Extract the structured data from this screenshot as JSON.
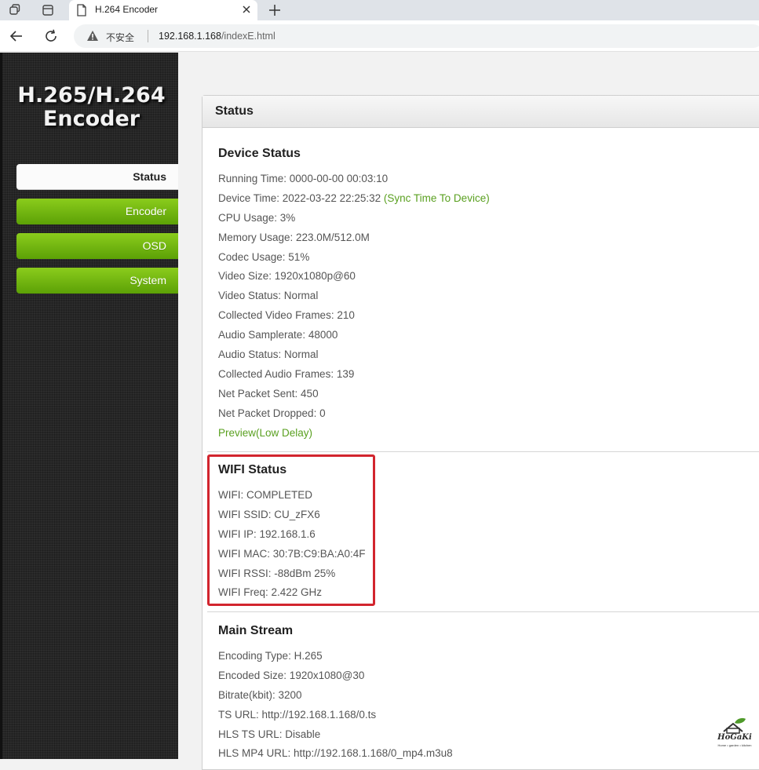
{
  "browser": {
    "tab_title": "H.264 Encoder",
    "security_label": "不安全",
    "url_host": "192.168.1.168",
    "url_path": "/indexE.html"
  },
  "sidebar": {
    "logo_line1": "H.265/H.264",
    "logo_line2": "Encoder",
    "items": [
      {
        "label": "Status",
        "active": true
      },
      {
        "label": "Encoder",
        "active": false
      },
      {
        "label": "OSD",
        "active": false
      },
      {
        "label": "System",
        "active": false
      }
    ]
  },
  "panel": {
    "title": "Status"
  },
  "device_status": {
    "title": "Device Status",
    "running_time": "Running Time: 0000-00-00 00:03:10",
    "device_time": "Device Time: 2022-03-22 22:25:32",
    "sync_link": "(Sync Time To Device)",
    "cpu_usage": "CPU Usage: 3%",
    "memory_usage": "Memory Usage: 223.0M/512.0M",
    "codec_usage": "Codec Usage: 51%",
    "video_size": "Video Size: 1920x1080p@60",
    "video_status": "Video Status: Normal",
    "video_frames": "Collected Video Frames: 210",
    "audio_samplerate": "Audio Samplerate: 48000",
    "audio_status": "Audio Status: Normal",
    "audio_frames": "Collected Audio Frames: 139",
    "packets_sent": "Net Packet Sent: 450",
    "packets_dropped": "Net Packet Dropped: 0",
    "preview_link": "Preview(Low Delay)"
  },
  "wifi_status": {
    "title": "WIFI Status",
    "state": "WIFI: COMPLETED",
    "ssid": "WIFI SSID: CU_zFX6",
    "ip": "WIFI IP: 192.168.1.6",
    "mac": "WIFI MAC: 30:7B:C9:BA:A0:4F",
    "rssi": "WIFI RSSI: -88dBm 25%",
    "freq": "WIFI Freq: 2.422 GHz"
  },
  "main_stream": {
    "title": "Main Stream",
    "encoding_type": "Encoding Type: H.265",
    "encoded_size": "Encoded Size: 1920x1080@30",
    "bitrate": "Bitrate(kbit): 3200",
    "ts_url": "TS URL: http://192.168.1.168/0.ts",
    "hls_ts_url": "HLS TS URL: Disable",
    "hls_mp4_url": "HLS MP4 URL: http://192.168.1.168/0_mp4.m3u8"
  },
  "watermark": {
    "brand": "HoGaKi",
    "tagline": "Home • garden • kitchen"
  },
  "colors": {
    "accent_green": "#6bb012",
    "link_green": "#5aa020",
    "highlight_red": "#d2252e"
  }
}
